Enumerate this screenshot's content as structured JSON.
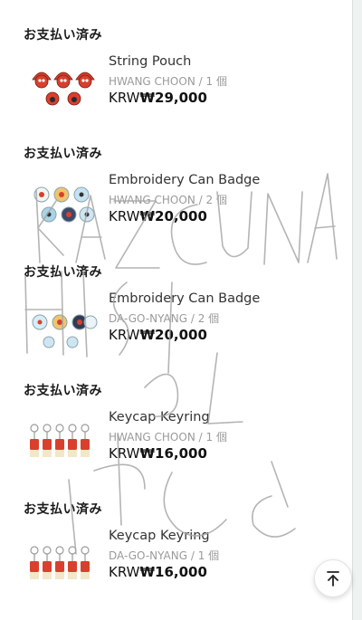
{
  "orders": [
    {
      "status": "お支払い済み",
      "name": "String Pouch",
      "artist": "HWANG CHOON",
      "sep": "/",
      "qty": "1 個",
      "currency": "KRW",
      "amount": "₩29,000",
      "thumb_icon": "pouch-thumbnail-icon"
    },
    {
      "status": "お支払い済み",
      "name": "Embroidery Can Badge",
      "artist": "HWANG CHOON",
      "sep": "/",
      "qty": "2 個",
      "currency": "KRW",
      "amount": "₩20,000",
      "thumb_icon": "badge-thumbnail-icon"
    },
    {
      "status": "お支払い済み",
      "name": "Embroidery Can Badge",
      "artist": "DA-GO-NYANG",
      "sep": "/",
      "qty": "2 個",
      "currency": "KRW",
      "amount": "₩20,000",
      "thumb_icon": "badge-thumbnail-icon"
    },
    {
      "status": "お支払い済み",
      "name": "Keycap Keyring",
      "artist": "HWANG CHOON",
      "sep": "/",
      "qty": "1 個",
      "currency": "KRW",
      "amount": "₩16,000",
      "thumb_icon": "keyring-thumbnail-icon"
    },
    {
      "status": "お支払い済み",
      "name": "Keycap Keyring",
      "artist": "DA-GO-NYANG",
      "sep": "/",
      "qty": "1 個",
      "currency": "KRW",
      "amount": "₩16,000",
      "thumb_icon": "keyring-thumbnail-icon"
    }
  ],
  "scroll_top_icon": "arrow-to-top-icon",
  "colors": {
    "background": "#ffffff",
    "side": "#eef2f1",
    "text": "#111111",
    "meta": "#9a9a9a",
    "red": "#d8402d"
  }
}
